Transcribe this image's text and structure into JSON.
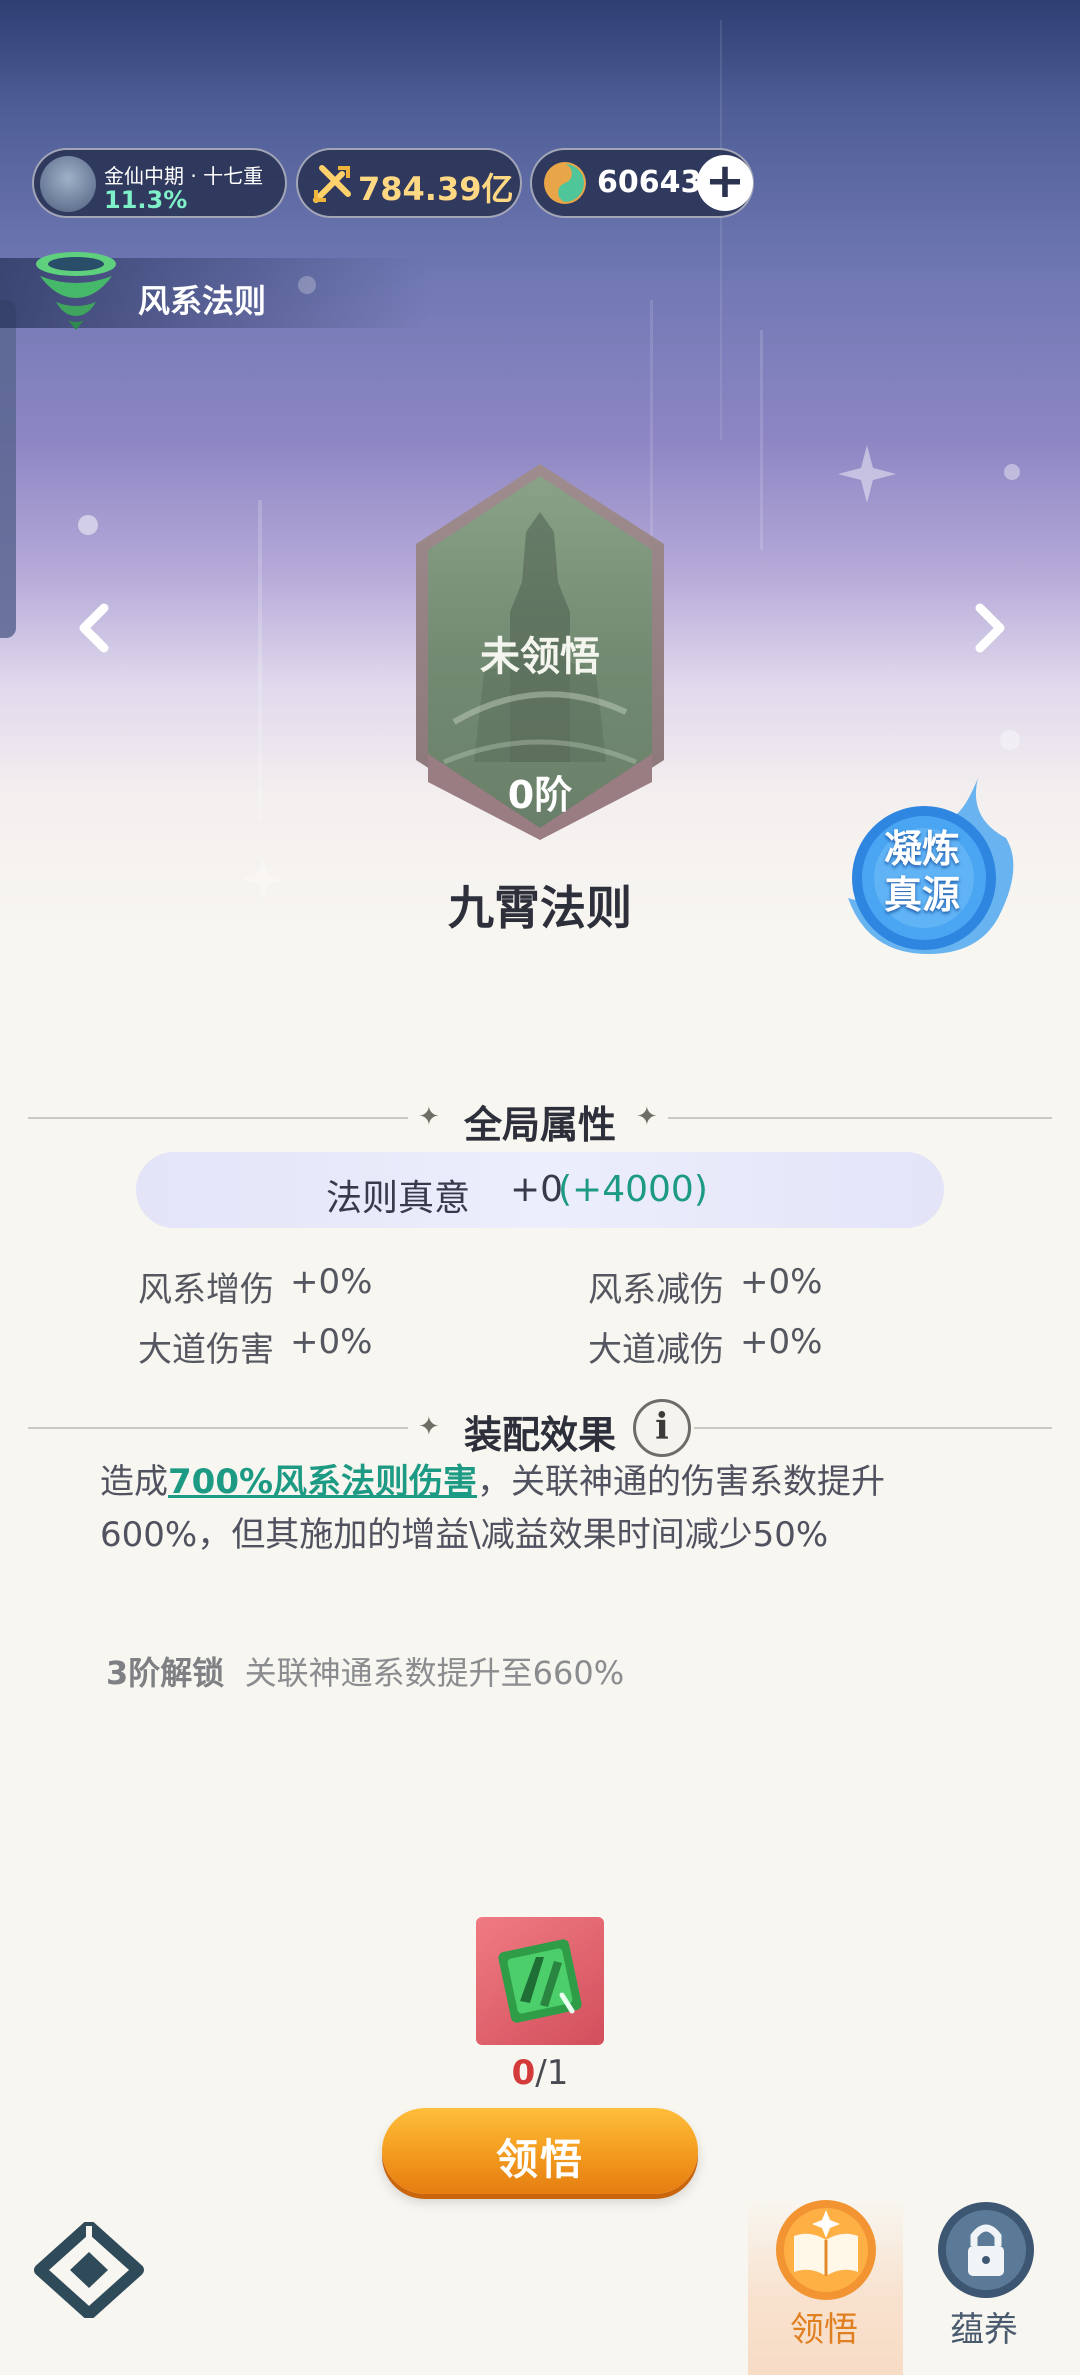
{
  "top_bar": {
    "realm_name": "金仙中期 · 十七重",
    "realm_progress": "11.3%",
    "combat_power": "784.39亿",
    "currency_amount": "60643",
    "add_label": "+"
  },
  "law_category": {
    "label": "风系法则"
  },
  "law": {
    "status": "未领悟",
    "tier": "0阶",
    "name": "九霄法则"
  },
  "refine_button": {
    "line1": "凝炼",
    "line2": "真源"
  },
  "global_attributes": {
    "title": "全局属性",
    "truth_label": "法则真意",
    "truth_value": "+0",
    "truth_bonus": "(+4000)",
    "stats": [
      {
        "label": "风系增伤",
        "value": "+0%"
      },
      {
        "label": "风系减伤",
        "value": "+0%"
      },
      {
        "label": "大道伤害",
        "value": "+0%"
      },
      {
        "label": "大道减伤",
        "value": "+0%"
      }
    ]
  },
  "equip_effect": {
    "title": "装配效果",
    "info_label": "i",
    "text_prefix": "造成",
    "text_highlight": "700%风系法则伤害",
    "text_line1_rest": "，关联神通的伤害系数提升",
    "text_line2": "600%，但其施加的增益\\减益效果时间减少50%"
  },
  "unlock": {
    "tier": "3阶解锁",
    "desc": "关联神通系数提升至660%"
  },
  "material": {
    "have": "0",
    "need": "/1"
  },
  "comprehend_button": {
    "label": "领悟"
  },
  "bottom_nav": {
    "tab1": "领悟",
    "tab2": "蕴养"
  },
  "colors": {
    "accent_teal": "#1c9a83",
    "button_orange": "#f39a1d",
    "count_red": "#d33b3b"
  }
}
